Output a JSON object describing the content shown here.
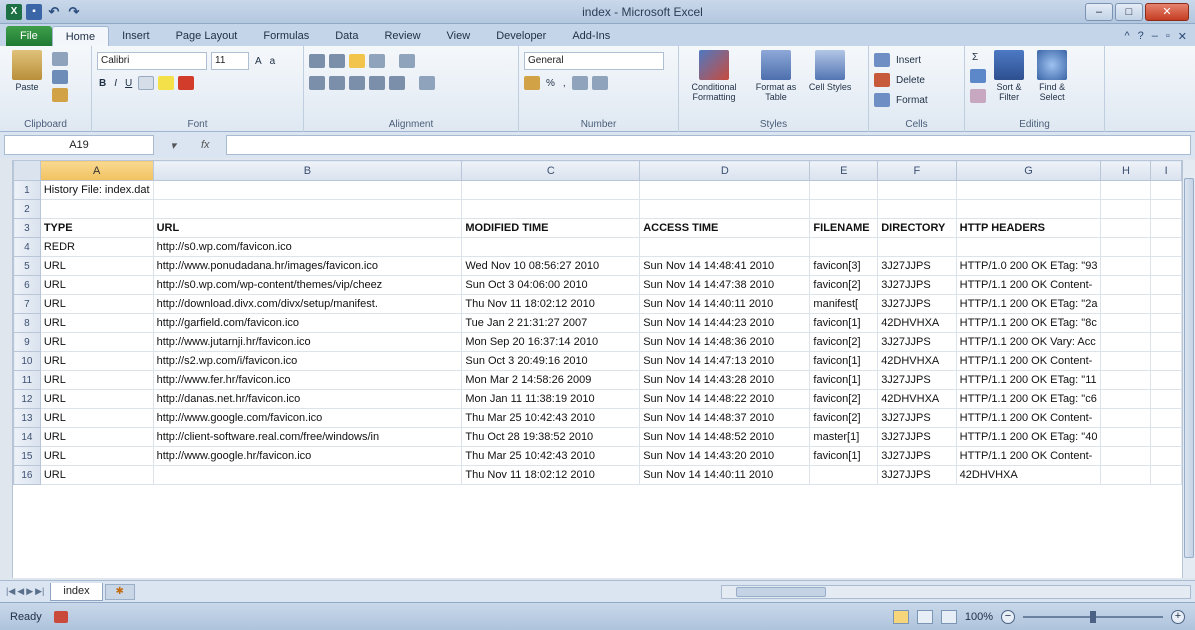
{
  "window": {
    "title": "index - Microsoft Excel"
  },
  "ribbon": {
    "tabs": [
      "File",
      "Home",
      "Insert",
      "Page Layout",
      "Formulas",
      "Data",
      "Review",
      "View",
      "Developer",
      "Add-Ins"
    ],
    "active_tab": "Home",
    "clipboard": {
      "paste": "Paste",
      "label": "Clipboard"
    },
    "font": {
      "name": "Calibri",
      "size": "11",
      "label": "Font"
    },
    "alignment": {
      "label": "Alignment"
    },
    "number": {
      "format": "General",
      "label": "Number"
    },
    "styles": {
      "conditional": "Conditional Formatting",
      "format_table": "Format as Table",
      "cell_styles": "Cell Styles",
      "label": "Styles"
    },
    "cells": {
      "insert": "Insert",
      "delete": "Delete",
      "format": "Format",
      "label": "Cells"
    },
    "editing": {
      "sort": "Sort & Filter",
      "find": "Find & Select",
      "label": "Editing"
    }
  },
  "formula_bar": {
    "name_box": "A19",
    "fx": "fx",
    "value": ""
  },
  "grid": {
    "selected_cell": "A19",
    "columns": [
      "A",
      "B",
      "C",
      "D",
      "E",
      "F",
      "G",
      "H",
      "I"
    ],
    "rows": [
      {
        "n": "1",
        "cells": [
          "History File: index.dat",
          "",
          "",
          "",
          "",
          "",
          "",
          "",
          ""
        ]
      },
      {
        "n": "2",
        "cells": [
          "",
          "",
          "",
          "",
          "",
          "",
          "",
          "",
          ""
        ]
      },
      {
        "n": "3",
        "bold": true,
        "cells": [
          "TYPE",
          "URL",
          "MODIFIED TIME",
          "ACCESS TIME",
          "FILENAME",
          "DIRECTORY",
          "HTTP HEADERS",
          "",
          ""
        ]
      },
      {
        "n": "4",
        "cells": [
          "REDR",
          "http://s0.wp.com/favicon.ico",
          "",
          "",
          "",
          "",
          "",
          "",
          ""
        ]
      },
      {
        "n": "5",
        "cells": [
          "URL",
          "http://www.ponudadana.hr/images/favicon.ico",
          "Wed Nov 10 08:56:27 2010",
          "Sun Nov 14 14:48:41 2010",
          "favicon[3]",
          "3J27JJPS",
          "HTTP/1.0 200 OK  ETag: \"93",
          "",
          ""
        ]
      },
      {
        "n": "6",
        "cells": [
          "URL",
          "http://s0.wp.com/wp-content/themes/vip/cheez",
          "Sun Oct  3 04:06:00 2010",
          "Sun Nov 14 14:47:38 2010",
          "favicon[2]",
          "3J27JJPS",
          "HTTP/1.1 200 OK  Content-",
          "",
          ""
        ]
      },
      {
        "n": "7",
        "cells": [
          "URL",
          "http://download.divx.com/divx/setup/manifest.",
          "Thu Nov 11 18:02:12 2010",
          "Sun Nov 14 14:40:11 2010",
          "manifest[",
          "3J27JJPS",
          "HTTP/1.1 200 OK  ETag: \"2a",
          "",
          ""
        ]
      },
      {
        "n": "8",
        "cells": [
          "URL",
          "http://garfield.com/favicon.ico",
          "Tue Jan  2 21:31:27 2007",
          "Sun Nov 14 14:44:23 2010",
          "favicon[1]",
          "42DHVHXA",
          "HTTP/1.1 200 OK  ETag: \"8c",
          "",
          ""
        ]
      },
      {
        "n": "9",
        "cells": [
          "URL",
          "http://www.jutarnji.hr/favicon.ico",
          "Mon Sep 20 16:37:14 2010",
          "Sun Nov 14 14:48:36 2010",
          "favicon[2]",
          "3J27JJPS",
          "HTTP/1.1 200 OK  Vary: Acc",
          "",
          ""
        ]
      },
      {
        "n": "10",
        "cells": [
          "URL",
          "http://s2.wp.com/i/favicon.ico",
          "Sun Oct  3 20:49:16 2010",
          "Sun Nov 14 14:47:13 2010",
          "favicon[1]",
          "42DHVHXA",
          "HTTP/1.1 200 OK  Content-",
          "",
          ""
        ]
      },
      {
        "n": "11",
        "cells": [
          "URL",
          "http://www.fer.hr/favicon.ico",
          "Mon Mar  2 14:58:26 2009",
          "Sun Nov 14 14:43:28 2010",
          "favicon[1]",
          "3J27JJPS",
          "HTTP/1.1 200 OK  ETag: \"11",
          "",
          ""
        ]
      },
      {
        "n": "12",
        "cells": [
          "URL",
          "http://danas.net.hr/favicon.ico",
          "Mon Jan 11 11:38:19 2010",
          "Sun Nov 14 14:48:22 2010",
          "favicon[2]",
          "42DHVHXA",
          "HTTP/1.1 200 OK  ETag: \"c6",
          "",
          ""
        ]
      },
      {
        "n": "13",
        "cells": [
          "URL",
          "http://www.google.com/favicon.ico",
          "Thu Mar 25 10:42:43 2010",
          "Sun Nov 14 14:48:37 2010",
          "favicon[2]",
          "3J27JJPS",
          "HTTP/1.1 200 OK  Content-",
          "",
          ""
        ]
      },
      {
        "n": "14",
        "cells": [
          "URL",
          "http://client-software.real.com/free/windows/in",
          "Thu Oct 28 19:38:52 2010",
          "Sun Nov 14 14:48:52 2010",
          "master[1]",
          "3J27JJPS",
          "HTTP/1.1 200 OK  ETag: \"40",
          "",
          ""
        ]
      },
      {
        "n": "15",
        "cells": [
          "URL",
          "http://www.google.hr/favicon.ico",
          "Thu Mar 25 10:42:43 2010",
          "Sun Nov 14 14:43:20 2010",
          "favicon[1]",
          "3J27JJPS",
          "HTTP/1.1 200 OK  Content-",
          "",
          ""
        ]
      },
      {
        "n": "16",
        "cells": [
          "URL",
          "",
          "Thu Nov 11 18:02:12 2010",
          "Sun Nov 14 14:40:11 2010",
          "",
          "3J27JJPS",
          "42DHVHXA",
          "",
          ""
        ]
      }
    ]
  },
  "sheets": {
    "tabs": [
      "index"
    ]
  },
  "status": {
    "mode": "Ready",
    "zoom": "100%",
    "zoom_fraction": 0.5
  },
  "colors": {
    "file_tab": "#1f7a34",
    "selection": "#f1c15f"
  }
}
